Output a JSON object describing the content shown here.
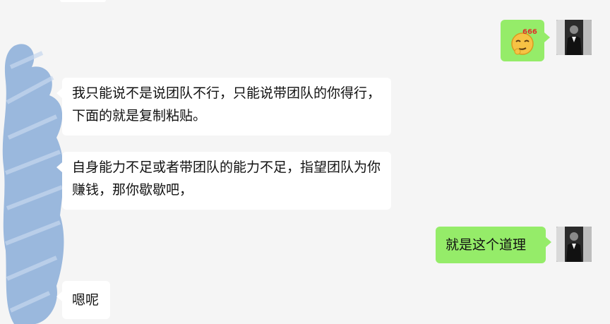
{
  "messages": [
    {
      "id": "m1",
      "side": "right",
      "type": "emoji",
      "emoji": "666-thinking-face"
    },
    {
      "id": "m2",
      "side": "left",
      "text": "我只能说不是说团队不行，只能说带团队的你得行，下面的就是复制粘贴。"
    },
    {
      "id": "m3",
      "side": "left",
      "text": "自身能力不足或者带团队的能力不足，指望团队为你赚钱，那你歇歇吧，"
    },
    {
      "id": "m4",
      "side": "right",
      "text": "就是这个道理"
    },
    {
      "id": "m5",
      "side": "left",
      "text": "嗯呢"
    }
  ],
  "emoji": {
    "label": "666"
  },
  "colors": {
    "background": "#f5f5f5",
    "self_bubble": "#95ec69",
    "other_bubble": "#ffffff",
    "redaction": "#9ab8dd"
  }
}
